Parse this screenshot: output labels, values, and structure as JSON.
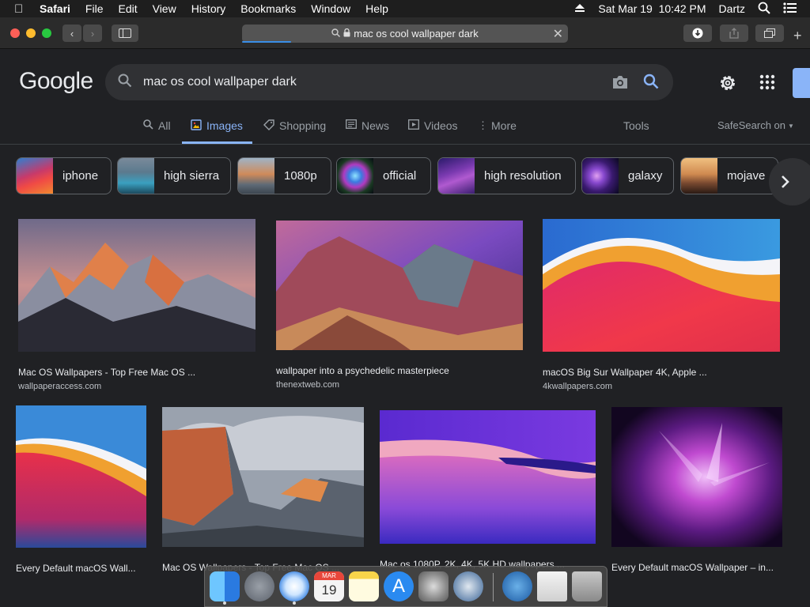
{
  "menubar": {
    "app": "Safari",
    "items": [
      "File",
      "Edit",
      "View",
      "History",
      "Bookmarks",
      "Window",
      "Help"
    ],
    "datetime": "Sat Mar 19  10:42 PM",
    "user": "Dartz"
  },
  "browser": {
    "address": "mac os cool wallpaper dark",
    "load_progress": 0.15
  },
  "google": {
    "logo": "Google",
    "query": "mac os cool wallpaper dark",
    "tabs": [
      "All",
      "Images",
      "Shopping",
      "News",
      "Videos",
      "More"
    ],
    "active_tab": "Images",
    "tools": "Tools",
    "safesearch": "SafeSearch on"
  },
  "chips": [
    {
      "label": "iphone"
    },
    {
      "label": "high sierra"
    },
    {
      "label": "1080p"
    },
    {
      "label": "official"
    },
    {
      "label": "high resolution"
    },
    {
      "label": "galaxy"
    },
    {
      "label": "mojave"
    }
  ],
  "results": [
    {
      "title": "Mac OS Wallpapers - Top Free Mac OS ...",
      "site": "wallpaperaccess.com"
    },
    {
      "title": "wallpaper into a psychedelic masterpiece",
      "site": "thenextweb.com"
    },
    {
      "title": "macOS Big Sur Wallpaper 4K, Apple ...",
      "site": "4kwallpapers.com"
    },
    {
      "title": "Every Default macOS Wall...",
      "site": ""
    },
    {
      "title": "Mac OS Wallpapers - Top Free Mac OS ...",
      "site": ""
    },
    {
      "title": "Mac os 1080P, 2K, 4K, 5K HD wallpapers ...",
      "site": ""
    },
    {
      "title": "Every Default macOS Wallpaper – in...",
      "site": ""
    }
  ],
  "dock": {
    "calendar_month": "MAR",
    "calendar_day": "19"
  }
}
